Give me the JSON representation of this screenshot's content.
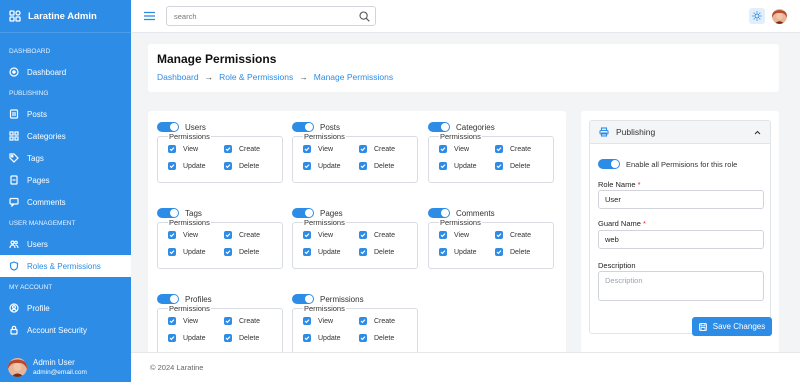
{
  "brand": {
    "name": "Laratine Admin"
  },
  "sidebar": {
    "sections": [
      {
        "title": "DASHBOARD"
      },
      {
        "title": "PUBLISHING"
      },
      {
        "title": "USER MANAGEMENT"
      },
      {
        "title": "MY ACCOUNT"
      }
    ],
    "items": {
      "dashboard": "Dashboard",
      "posts": "Posts",
      "categories": "Categories",
      "tags": "Tags",
      "pages": "Pages",
      "comments": "Comments",
      "users": "Users",
      "roles": "Roles & Permissions",
      "profile": "Profile",
      "security": "Account Security"
    },
    "user": {
      "name": "Admin User",
      "email": "admin@email.com"
    }
  },
  "topbar": {
    "search_placeholder": "search"
  },
  "header": {
    "title": "Manage Permissions",
    "breadcrumb": [
      "Dashboard",
      "Role & Permissions",
      "Manage Permissions"
    ],
    "separator": "→"
  },
  "permissions": {
    "legend": "Permissions",
    "actions": [
      "View",
      "Create",
      "Update",
      "Delete"
    ],
    "groups": [
      {
        "title": "Users",
        "enabled": true
      },
      {
        "title": "Posts",
        "enabled": true
      },
      {
        "title": "Categories",
        "enabled": true
      },
      {
        "title": "Tags",
        "enabled": true
      },
      {
        "title": "Pages",
        "enabled": true
      },
      {
        "title": "Comments",
        "enabled": true
      },
      {
        "title": "Profiles",
        "enabled": true
      },
      {
        "title": "Permissions",
        "enabled": true
      }
    ]
  },
  "role": {
    "panel_title": "Publishing",
    "enable_all_label": "Enable all Permisions for this role",
    "role_name_label": "Role Name",
    "role_name_value": "User",
    "guard_name_label": "Guard Name",
    "guard_name_value": "web",
    "description_label": "Description",
    "description_placeholder": "Description",
    "required_mark": "*",
    "save_label": "Save Changes"
  },
  "footer": {
    "text": "© 2024 Laratine"
  },
  "colors": {
    "primary": "#2d8ce6",
    "background": "#f3f4f6",
    "required": "#dc2626"
  }
}
